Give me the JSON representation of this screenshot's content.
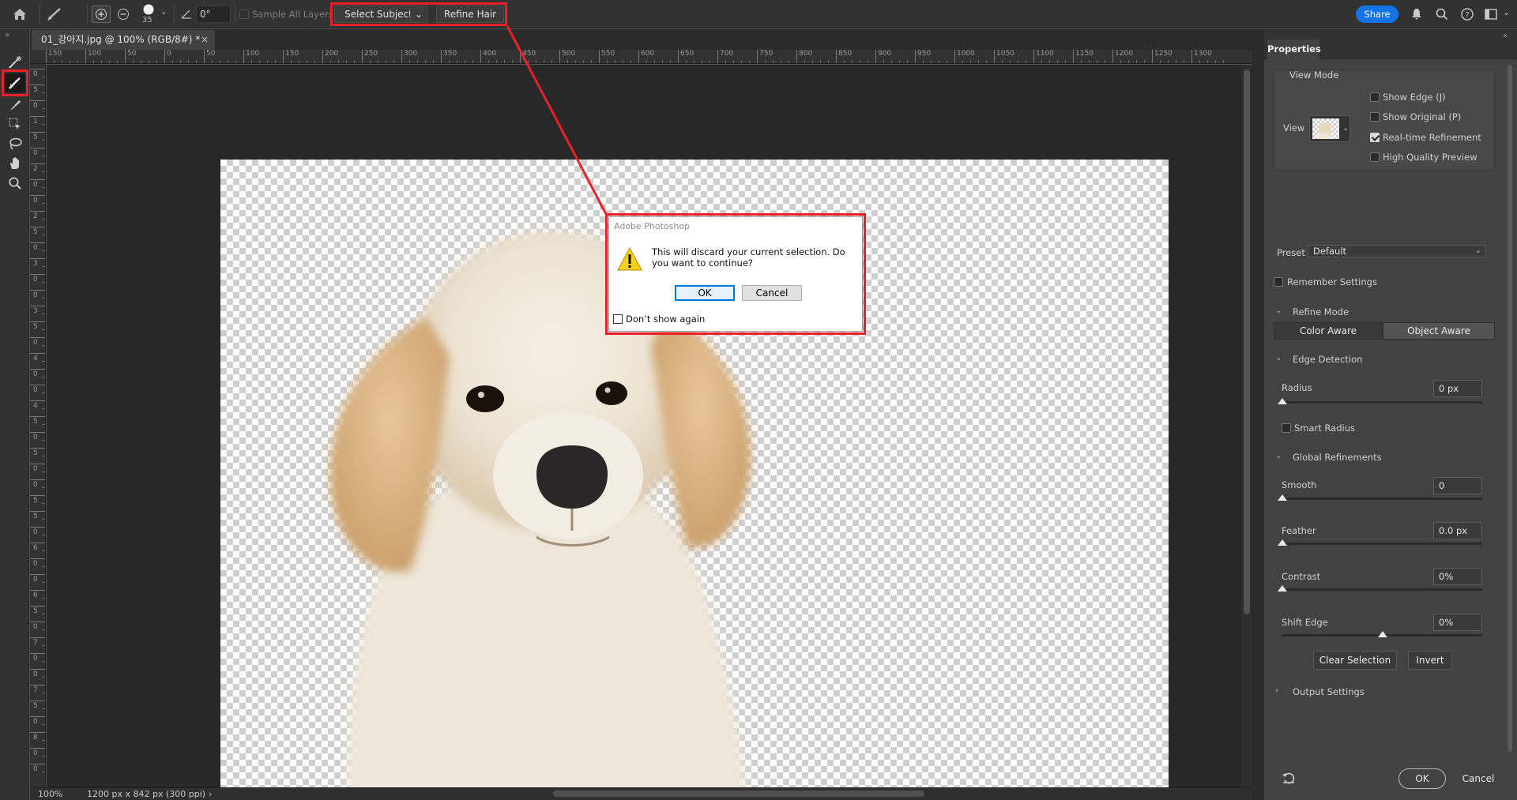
{
  "options_bar": {
    "brush_size": "35",
    "angle": "0°",
    "sample_all_layers": "Sample All Layers",
    "select_subject": "Select Subject",
    "refine_hair": "Refine Hair",
    "share": "Share"
  },
  "document": {
    "tab_title": "01_강아지.jpg @ 100% (RGB/8#) *",
    "close": "×"
  },
  "ruler": {
    "top": [
      "150",
      "100",
      "50",
      "0",
      "50",
      "100",
      "150",
      "200",
      "250",
      "300",
      "350",
      "400",
      "450",
      "500",
      "550",
      "600",
      "650",
      "700",
      "750",
      "800",
      "850",
      "900",
      "950",
      "1000",
      "1050",
      "1100",
      "1150",
      "1200",
      "1250",
      "1300"
    ],
    "left": [
      "0",
      "5",
      "0",
      "1",
      "5",
      "0",
      "2",
      "0",
      "0",
      "2",
      "5",
      "0",
      "3",
      "0",
      "0",
      "3",
      "5",
      "0",
      "4",
      "0",
      "0",
      "4",
      "5",
      "0",
      "5",
      "0",
      "0",
      "5",
      "5",
      "0",
      "6",
      "0",
      "0",
      "6",
      "5",
      "0",
      "7",
      "0",
      "0",
      "7",
      "5",
      "0",
      "8",
      "0",
      "0"
    ]
  },
  "status": {
    "zoom": "100%",
    "info": "1200 px x 842 px (300 ppi)",
    "arrow": "›"
  },
  "dialog": {
    "title": "Adobe Photoshop",
    "message": "This will discard your current selection. Do you want to continue?",
    "ok": "OK",
    "cancel": "Cancel",
    "dont_show": "Don’t show again"
  },
  "properties": {
    "tab": "Properties",
    "view_mode": "View Mode",
    "view": "View",
    "show_edge": "Show Edge (J)",
    "show_original": "Show Original (P)",
    "realtime": "Real-time Refinement",
    "hq_preview": "High Quality Preview",
    "preset_label": "Preset",
    "preset_value": "Default",
    "remember": "Remember Settings",
    "refine_mode": "Refine Mode",
    "color_aware": "Color Aware",
    "object_aware": "Object Aware",
    "edge_detection": "Edge Detection",
    "radius_label": "Radius",
    "radius_value": "0 px",
    "smart_radius": "Smart Radius",
    "global_refinements": "Global Refinements",
    "smooth_label": "Smooth",
    "smooth_value": "0",
    "feather_label": "Feather",
    "feather_value": "0.0 px",
    "contrast_label": "Contrast",
    "contrast_value": "0%",
    "shift_label": "Shift Edge",
    "shift_value": "0%",
    "clear_selection": "Clear Selection",
    "invert": "Invert",
    "output_settings": "Output Settings",
    "ok": "OK",
    "cancel": "Cancel"
  },
  "colors": {
    "highlight": "#e8202a",
    "share_blue": "#1473e6"
  }
}
